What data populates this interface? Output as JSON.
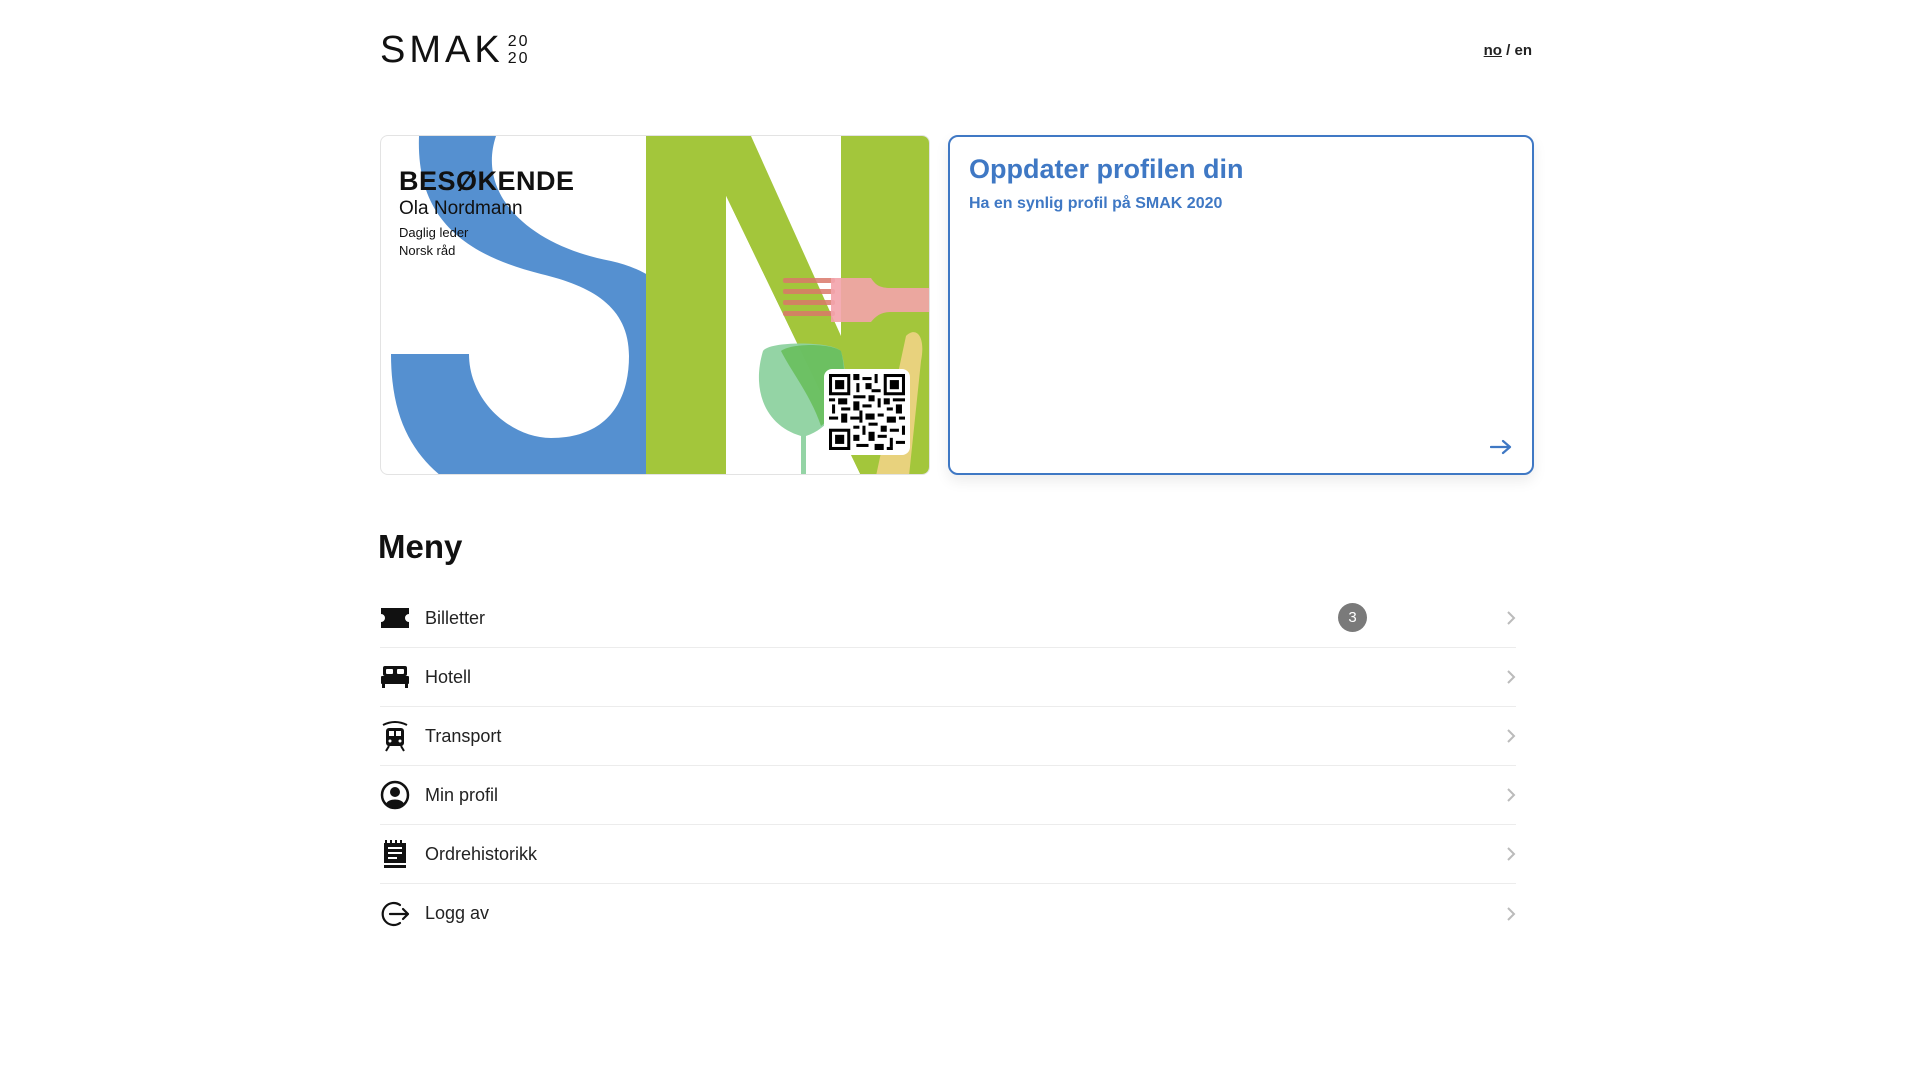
{
  "header": {
    "logo_main": "SMAK",
    "logo_year_top": "20",
    "logo_year_bottom": "20",
    "lang_active": "no",
    "lang_sep": " / ",
    "lang_other": "en"
  },
  "card": {
    "role": "BESØKENDE",
    "name": "Ola Nordmann",
    "job_title": "Daglig leder",
    "organization": "Norsk råd",
    "colors": {
      "blue": "#5590d0",
      "green": "#a3c63b",
      "pink": "#f3a3ab",
      "sage": "#8ed2a0"
    }
  },
  "promo": {
    "title": "Oppdater profilen din",
    "subtitle": "Ha en synlig profil på SMAK 2020",
    "accent": "#3f78c4"
  },
  "menu": {
    "heading": "Meny",
    "items": [
      {
        "label": "Billetter",
        "icon": "ticket-icon",
        "badge": "3"
      },
      {
        "label": "Hotell",
        "icon": "bed-icon"
      },
      {
        "label": "Transport",
        "icon": "train-icon"
      },
      {
        "label": "Min profil",
        "icon": "user-circle-icon"
      },
      {
        "label": "Ordrehistorikk",
        "icon": "receipt-icon"
      },
      {
        "label": "Logg av",
        "icon": "logout-icon"
      }
    ]
  }
}
